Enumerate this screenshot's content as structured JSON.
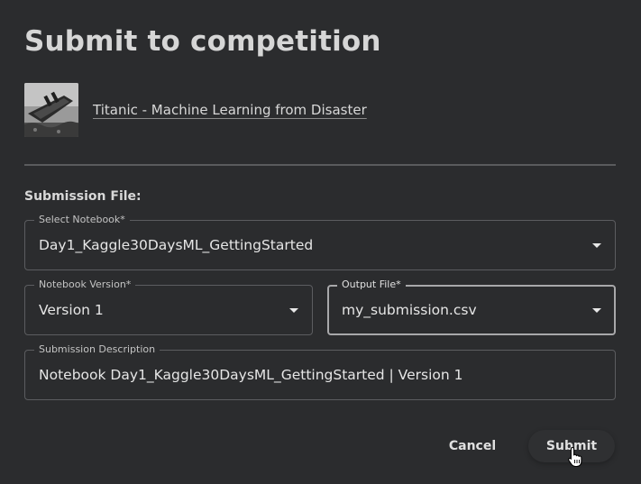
{
  "dialog": {
    "title": "Submit to competition"
  },
  "competition": {
    "thumbnail_icon": "titanic-ship-image",
    "link_text": "Titanic - Machine Learning from Disaster"
  },
  "form": {
    "section_label": "Submission File:",
    "notebook": {
      "label": "Select Notebook*",
      "value": "Day1_Kaggle30DaysML_GettingStarted"
    },
    "version": {
      "label": "Notebook Version*",
      "value": "Version 1"
    },
    "output": {
      "label": "Output File*",
      "value": "my_submission.csv"
    },
    "description": {
      "label": "Submission Description",
      "value": "Notebook Day1_Kaggle30DaysML_GettingStarted | Version 1"
    }
  },
  "actions": {
    "cancel_label": "Cancel",
    "submit_label": "Submit"
  },
  "colors": {
    "background": "#2b2c2e",
    "border": "#5c5d60",
    "text": "#e6e6e6"
  }
}
